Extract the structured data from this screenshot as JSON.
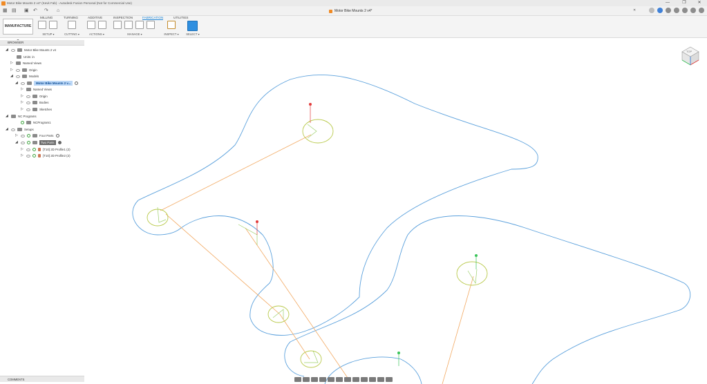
{
  "window": {
    "title": "Motor Bike Mounts 2 v4* (Kevk Fab) - Autodesk Fusion Personal (Not for Commercial Use)",
    "controls": [
      "—",
      "❐",
      "✕"
    ]
  },
  "doc_tab": {
    "label": "Motor Bike Mounts 2 v4*",
    "close": "✕"
  },
  "workspace": "MANUFACTURE ▾",
  "ribbon_tabs": [
    {
      "label": "MILLING"
    },
    {
      "label": "TURNING"
    },
    {
      "label": "ADDITIVE"
    },
    {
      "label": "INSPECTION"
    },
    {
      "label": "FABRICATION"
    },
    {
      "label": "UTILITIES"
    }
  ],
  "ribbon_groups": [
    {
      "label": "SETUP ▾"
    },
    {
      "label": "CUTTING ▾"
    },
    {
      "label": "ACTIONS ▾"
    },
    {
      "label": "MANAGE ▾"
    },
    {
      "label": "INSPECT ▾"
    },
    {
      "label": "SELECT ▾"
    }
  ],
  "browser": {
    "title": "BROWSER"
  },
  "tree": [
    {
      "label": "Motor Bike Mounts 2 v4"
    },
    {
      "label": "Units: in"
    },
    {
      "label": "Named Views"
    },
    {
      "label": "Origin"
    },
    {
      "label": "Models"
    },
    {
      "label": "Motor Bike Mounts 2 v..."
    },
    {
      "label": "Named Views"
    },
    {
      "label": "Origin"
    },
    {
      "label": "Bodies"
    },
    {
      "label": "Sketches"
    },
    {
      "label": "NC Programs"
    },
    {
      "label": "NCProgram1"
    },
    {
      "label": "Setups"
    },
    {
      "label": "Four Parts"
    },
    {
      "label": "Two Parts"
    },
    {
      "label": "[T10] 2D Profile1 (2)"
    },
    {
      "label": "[T10] 2D Profile2 (2)"
    }
  ],
  "comments": {
    "title": "COMMENTS"
  },
  "viewcube": {
    "face": "TOP"
  },
  "colors": {
    "accent": "#1f86d6",
    "profile": "#5aa0dc",
    "toolpath": "#f2a860",
    "hole": "#b8c94a",
    "start_marker": "#e23b3b",
    "end_marker": "#3bc45a"
  }
}
